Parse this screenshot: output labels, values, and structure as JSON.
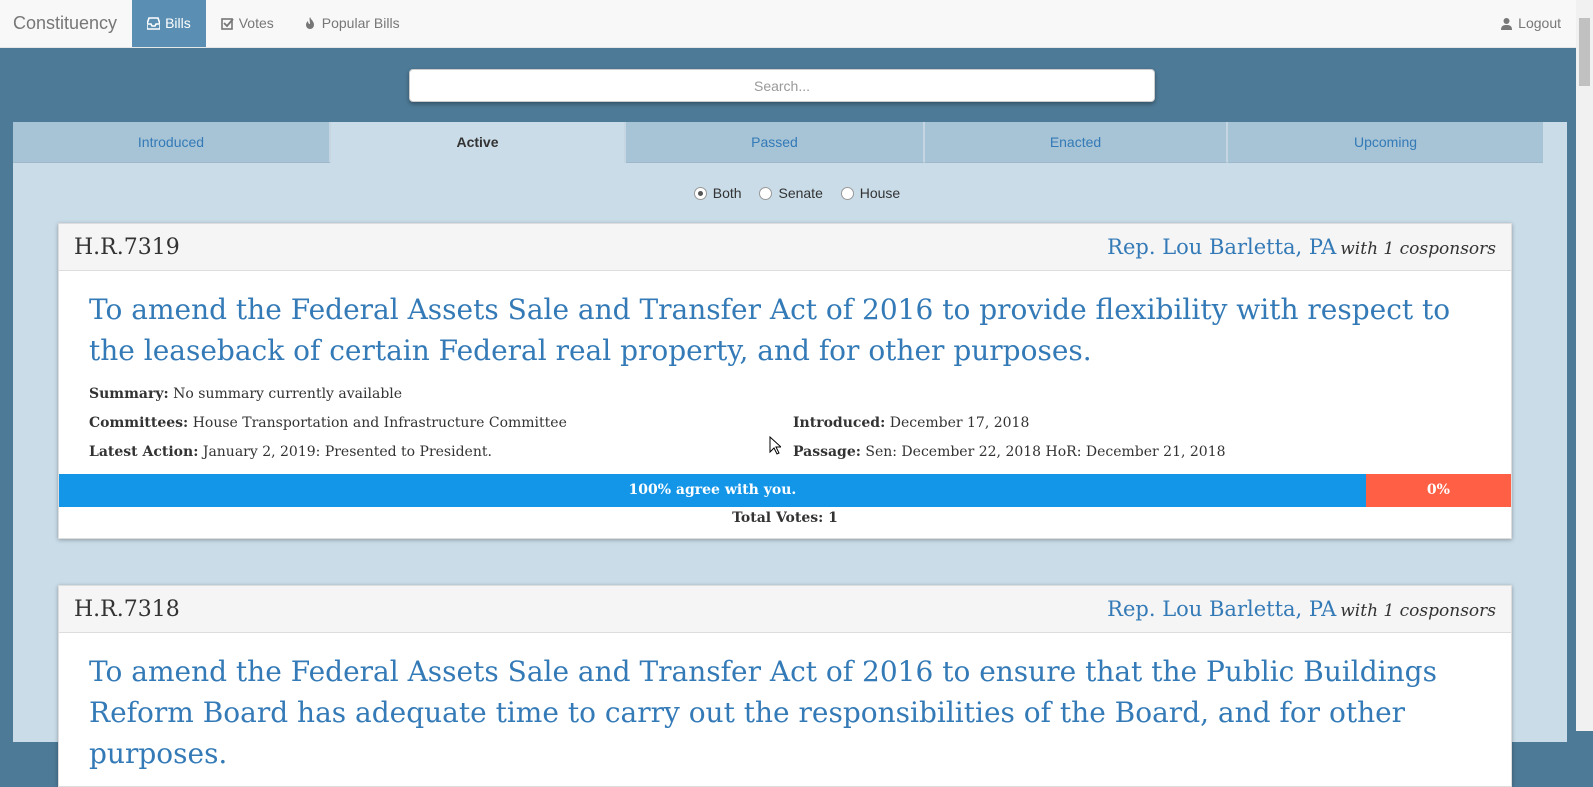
{
  "navbar": {
    "brand": "Constituency",
    "items": [
      {
        "label": "Bills",
        "icon": "inbox-icon",
        "active": true
      },
      {
        "label": "Votes",
        "icon": "check-square-icon",
        "active": false
      },
      {
        "label": "Popular Bills",
        "icon": "fire-icon",
        "active": false
      }
    ],
    "logout": {
      "label": "Logout",
      "icon": "user-icon"
    }
  },
  "search": {
    "placeholder": "Search..."
  },
  "tabs": [
    "Introduced",
    "Active",
    "Passed",
    "Enacted",
    "Upcoming"
  ],
  "active_tab": "Active",
  "chamber_filter": {
    "options": [
      "Both",
      "Senate",
      "House"
    ],
    "selected": "Both"
  },
  "bills": [
    {
      "id": "H.R.7319",
      "sponsor": "Rep. Lou Barletta, PA",
      "cosponsors": "with 1 cosponsors",
      "title": "To amend the Federal Assets Sale and Transfer Act of 2016 to provide flexibility with respect to the leaseback of certain Federal real property, and for other purposes.",
      "summary_label": "Summary:",
      "summary": "No summary currently available",
      "committees_label": "Committees:",
      "committees": "House Transportation and Infrastructure Committee",
      "introduced_label": "Introduced:",
      "introduced": "December 17, 2018",
      "latest_action_label": "Latest Action:",
      "latest_action": "January 2, 2019: Presented to President.",
      "passage_label": "Passage:",
      "passage": "Sen: December 22, 2018 HoR: December 21, 2018",
      "agree_text": "100% agree with you.",
      "agree_fraction": 0.9,
      "disagree_text": "0%",
      "total_votes": "Total Votes: 1"
    },
    {
      "id": "H.R.7318",
      "sponsor": "Rep. Lou Barletta, PA",
      "cosponsors": "with 1 cosponsors",
      "title": "To amend the Federal Assets Sale and Transfer Act of 2016 to ensure that the Public Buildings Reform Board has adequate time to carry out the responsibilities of the Board, and for other purposes."
    }
  ],
  "colors": {
    "background": "#4d7a97",
    "navbar_active": "#5a8fb3",
    "link": "#337ab7",
    "agree": "#1396e8",
    "disagree": "#ff5f45"
  }
}
